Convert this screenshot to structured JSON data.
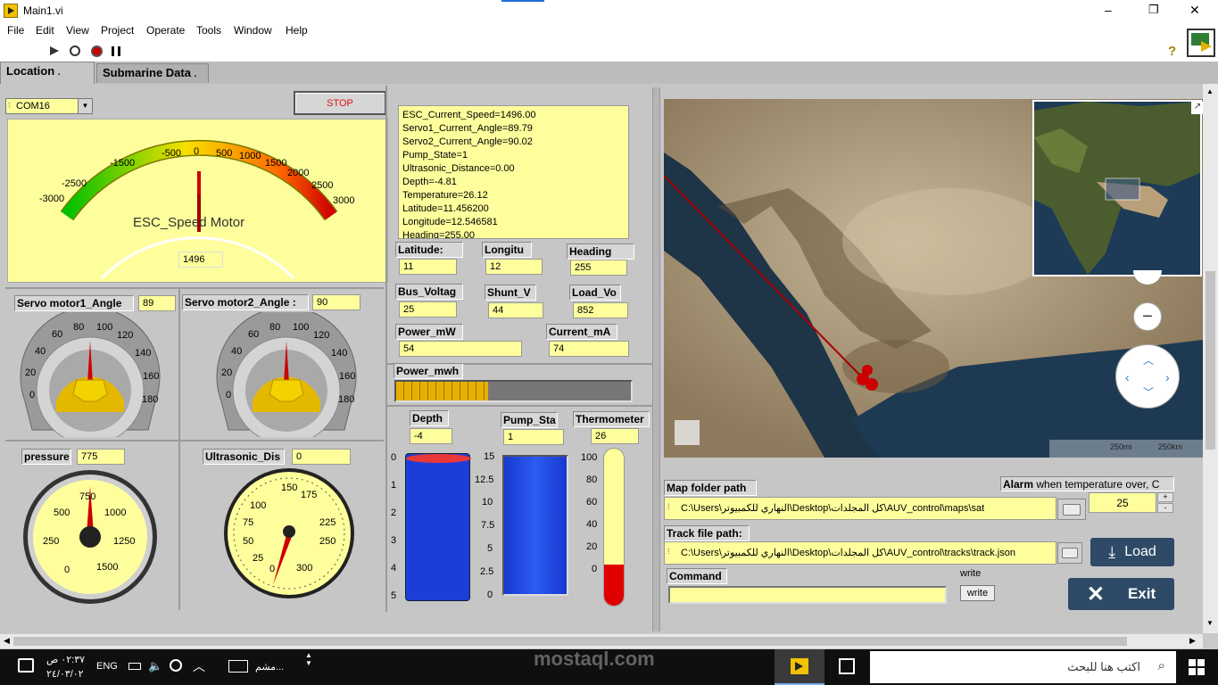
{
  "window": {
    "title": "Main1.vi",
    "min": "‒",
    "max": "❐",
    "close": "✕"
  },
  "menu": [
    "File",
    "Edit",
    "View",
    "Project",
    "Operate",
    "Tools",
    "Window",
    "Help"
  ],
  "tabs": [
    {
      "label": "Location"
    },
    {
      "label": "Submarine Data"
    }
  ],
  "com": {
    "value": "COM16"
  },
  "stop": {
    "label": "STOP"
  },
  "esc": {
    "title": "ESC_Speed Motor",
    "value": "1496",
    "ticks": [
      "-3000",
      "-2500",
      "-1500",
      "-500",
      "0",
      "500",
      "1000",
      "1500",
      "2000",
      "2500",
      "3000"
    ]
  },
  "status_text": [
    "ESC_Current_Speed=1496.00",
    "Servo1_Current_Angle=89.79",
    "Servo2_Current_Angle=90.02",
    "Pump_State=1",
    "Ultrasonic_Distance=0.00",
    "Depth=-4.81",
    "Temperature=26.12",
    "Latitude=11.456200",
    "Longitude=12.546581",
    "Heading=255.00"
  ],
  "fields": {
    "latitude": {
      "label": "Latitude:",
      "value": "11"
    },
    "longitude": {
      "label": "Longitu",
      "value": "12"
    },
    "heading": {
      "label": "Heading",
      "value": "255"
    },
    "bus_voltage": {
      "label": "Bus_Voltag",
      "value": "25"
    },
    "shunt_v": {
      "label": "Shunt_V",
      "value": "44"
    },
    "load_v": {
      "label": "Load_Vo",
      "value": "852"
    },
    "power_mw": {
      "label": "Power_mW",
      "value": "54"
    },
    "current_ma": {
      "label": "Current_mA",
      "value": "74"
    },
    "power_mwh": {
      "label": "Power_mwh",
      "fill": 0.39
    }
  },
  "servo1": {
    "label": "Servo motor1_Angle",
    "value": "89",
    "ticks": [
      "0",
      "20",
      "40",
      "60",
      "80",
      "100",
      "120",
      "140",
      "160",
      "180"
    ]
  },
  "servo2": {
    "label": "Servo motor2_Angle :",
    "value": "90",
    "ticks": [
      "0",
      "20",
      "40",
      "60",
      "80",
      "100",
      "120",
      "140",
      "160",
      "180"
    ]
  },
  "pressure": {
    "label": "pressure",
    "value": "775",
    "ticks": [
      "0",
      "250",
      "500",
      "750",
      "1000",
      "1250",
      "1500"
    ]
  },
  "ultrasonic": {
    "label": "Ultrasonic_Dis",
    "value": "0",
    "ticks": [
      "0",
      "25",
      "50",
      "75",
      "100",
      "150",
      "175",
      "225",
      "250",
      "300"
    ]
  },
  "depth": {
    "label": "Depth",
    "value": "-4",
    "ticks": [
      "0",
      "1",
      "2",
      "3",
      "4",
      "5"
    ]
  },
  "pump": {
    "label": "Pump_Sta",
    "value": "1",
    "ticks": [
      "15",
      "12.5",
      "10",
      "7.5",
      "5",
      "2.5",
      "0"
    ]
  },
  "thermo": {
    "label": "Thermometer",
    "value": "26",
    "ticks": [
      "100",
      "80",
      "60",
      "40",
      "20",
      "0"
    ],
    "level": 26
  },
  "map": {
    "scale_mi": "250mi",
    "scale_km": "250km",
    "minus": "−"
  },
  "map_folder": {
    "label": "Map folder path",
    "value": "C:\\Users\\النهاري للكمبيوتر\\Desktop\\كل المجلدات\\AUV_control\\maps\\sat"
  },
  "alarm": {
    "label_bold": "Alarm",
    "label_rest": " when temperature over, C",
    "value": "25"
  },
  "track": {
    "label": "Track file path:",
    "value": "C:\\Users\\النهاري للكمبيوتر\\Desktop\\كل المجلدات\\AUV_control\\tracks\\track.json"
  },
  "load": {
    "label": "Load"
  },
  "command": {
    "label": "Command",
    "value": "",
    "write_caption": "write",
    "write_label": "write"
  },
  "exit": {
    "label": "Exit"
  },
  "taskbar": {
    "search_placeholder": "اكتب هنا للبحث",
    "time": "٠٢:٣٧ ص",
    "date": "٢٤/٠٣/٠٢",
    "lang": "ENG",
    "app": "مشم..."
  },
  "watermark": {
    "text": "mostaql.com"
  }
}
